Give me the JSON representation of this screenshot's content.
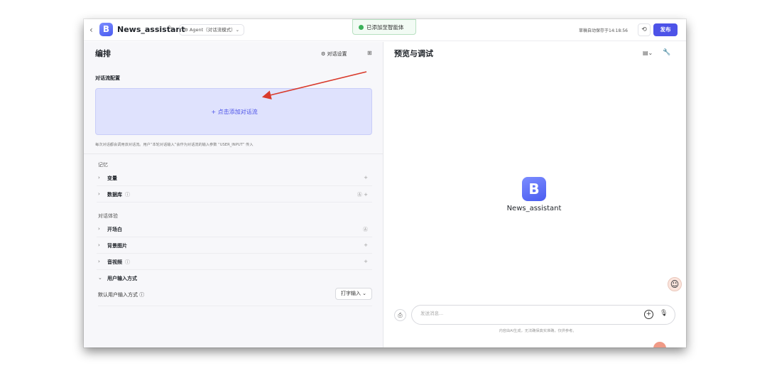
{
  "header": {
    "back_glyph": "‹",
    "app_logo_letter": "B",
    "app_name": "News_assistant",
    "mode_label": "⚙ Agent（对话流模式）⌄",
    "toast": "已添加至智能体",
    "save_time": "草稿自动保存于14:18:56",
    "publish_label": "发布"
  },
  "left_panel": {
    "title": "编排",
    "dialog_settings_label": "对话设置",
    "section_title": "对话流配置",
    "add_flow_label": "+ 点击添加对话流",
    "hint": "每次对话都会调用该对话流。用户“本轮对话输入”会作为对话流的输入参数 “USER_INPUT” 传入",
    "memory_group": "记忆",
    "memory_items": [
      {
        "label": "变量",
        "action": "+"
      },
      {
        "label": "数据库",
        "info": "ⓘ",
        "action": "Ⓐ  +"
      }
    ],
    "experience_group": "对话体验",
    "experience_items": [
      {
        "label": "开场白",
        "action": "Ⓐ"
      },
      {
        "label": "背景图片",
        "action": "+"
      },
      {
        "label": "音视频",
        "info": "ⓘ",
        "action": "+"
      },
      {
        "label": "用户输入方式",
        "chevron": "⌄"
      }
    ],
    "input_method": {
      "label": "默认用户输入方式 ⓘ",
      "selected": "打字输入 ⌄"
    }
  },
  "right_panel": {
    "title": "预览与调试",
    "bot_logo_letter": "B",
    "bot_name": "News_assistant",
    "message_placeholder": "发送消息...",
    "disclaimer": "内容由AI生成，无法确保真实准确，仅供参考。"
  },
  "colors": {
    "accent": "#4d53e8",
    "add_box_bg": "#dfe2fd",
    "toast_green": "#3cb15a",
    "annotation_arrow": "#d93a2b"
  }
}
